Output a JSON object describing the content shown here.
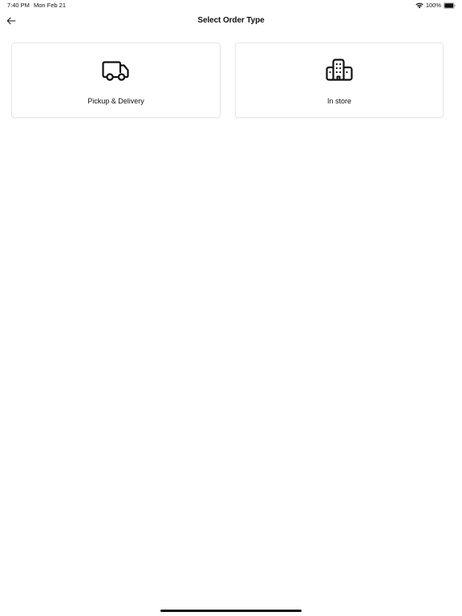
{
  "status_bar": {
    "time": "7:40 PM",
    "date": "Mon Feb 21",
    "battery_percent": "100%",
    "battery_level": 1.0,
    "icons": [
      "wifi-icon",
      "battery-icon"
    ]
  },
  "header": {
    "title": "Select Order Type",
    "back_icon": "arrow-left-icon"
  },
  "order_types": [
    {
      "label": "Pickup & Delivery",
      "icon": "truck-icon"
    },
    {
      "label": "In store",
      "icon": "building-icon"
    }
  ],
  "colors": {
    "background": "#ffffff",
    "text": "#111111",
    "card_border": "#e8e8e8"
  }
}
